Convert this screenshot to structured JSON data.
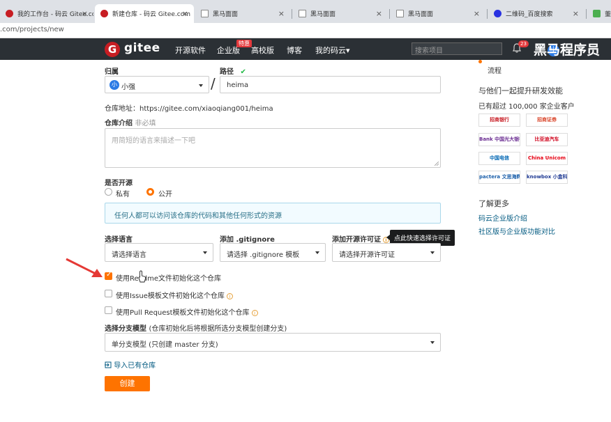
{
  "browser": {
    "tabs": [
      {
        "label": "我的工作台 - 码云 Gitee.co",
        "icon": "gitee-icon"
      },
      {
        "label": "新建仓库 - 码云 Gitee.com",
        "icon": "gitee-icon",
        "active": true
      },
      {
        "label": "黑马面面",
        "icon": "document-icon"
      },
      {
        "label": "黑马面面",
        "icon": "document-icon"
      },
      {
        "label": "黑马面面",
        "icon": "document-icon"
      },
      {
        "label": "二维码_百度搜索",
        "icon": "baidu-icon"
      },
      {
        "label": "董科",
        "icon": "app-icon"
      }
    ],
    "tab_close": "×",
    "url": ".com/projects/new"
  },
  "header": {
    "logo_letter": "G",
    "logo_text": "gitee",
    "nav": [
      "开源软件",
      "企业版",
      "高校版",
      "博客",
      "我的码云"
    ],
    "nav_dropdown_caret": "▾",
    "hot_badge": "特惠",
    "search_placeholder": "搜索项目",
    "notification_count": "23",
    "avatar_letter": "小",
    "watermark": "黑马程序员"
  },
  "form": {
    "owner_label": "归属",
    "owner_avatar": "小",
    "owner_value": "小强",
    "path_label": "路径",
    "path_check": "✔",
    "path_sep": "/",
    "path_value": "heima",
    "repo_address": "仓库地址：https://gitee.com/xiaoqiang001/heima",
    "intro_label": "仓库介绍",
    "intro_optional": "非必填",
    "intro_placeholder": "用简短的语言来描述一下吧",
    "open_label": "是否开源",
    "private_label": "私有",
    "public_label": "公开",
    "visibility_selected": "public",
    "public_notice": "任何人都可以访问该仓库的代码和其他任何形式的资源",
    "language_label": "选择语言",
    "language_value": "请选择语言",
    "gitignore_label": "添加 .gitignore",
    "gitignore_value": "请选择 .gitignore 模板",
    "license_label": "添加开源许可证",
    "license_value": "请选择开源许可证",
    "license_tooltip": "点此快速选择许可证",
    "info_glyph": "i",
    "readme_label": "使用Readme文件初始化这个仓库",
    "readme_checked": true,
    "issue_label": "使用Issue模板文件初始化这个仓库",
    "issue_checked": false,
    "pr_label": "使用Pull Request模板文件初始化这个仓库",
    "pr_checked": false,
    "branch_label": "选择分支模型",
    "branch_hint": "(仓库初始化后将根据所选分支模型创建分支)",
    "branch_value": "单分支模型 (只创建 master 分支)",
    "import_link": "导入已有仓库",
    "create_button": "创建"
  },
  "sidebar": {
    "top_text": "流程",
    "enterprise_title": "与他们一起提升研发效能",
    "enterprise_sub": "已有超过 100,000 家企业客户",
    "logos": [
      "招商银行",
      "招商证券",
      "Bank 中国光大银行",
      "比亚迪汽车",
      "中国电信",
      "China Unicom",
      "pactera 文思海辉",
      "knowbox 小盒科技"
    ],
    "more_title": "了解更多",
    "links": [
      "码云企业版介绍",
      "社区版与企业版功能对比"
    ]
  },
  "colors": {
    "accent": "#fe7300",
    "header_bg": "#2b3035",
    "link": "#005980",
    "notice_bg": "#f2fbff",
    "notice_border": "#a9d7ea",
    "arrow": "#e53935"
  }
}
